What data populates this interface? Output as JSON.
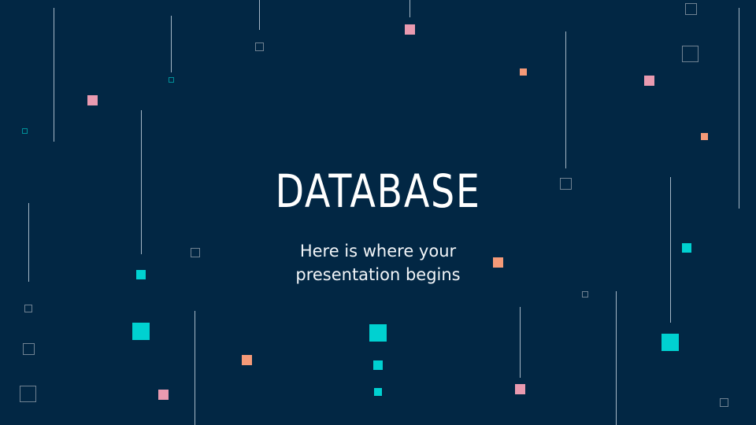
{
  "slide": {
    "title": "DATABASE",
    "subtitle_line1": "Here is where your",
    "subtitle_line2": "presentation begins"
  },
  "colors": {
    "background": "#022744",
    "teal": "#00D1D1",
    "pink": "#E99AB0",
    "orange": "#F59A78",
    "line": "#DCE8F2",
    "outline": "#A0AAB4"
  },
  "decorations": {
    "shapes": [
      "vertical-lines",
      "filled-squares",
      "outlined-squares"
    ]
  }
}
